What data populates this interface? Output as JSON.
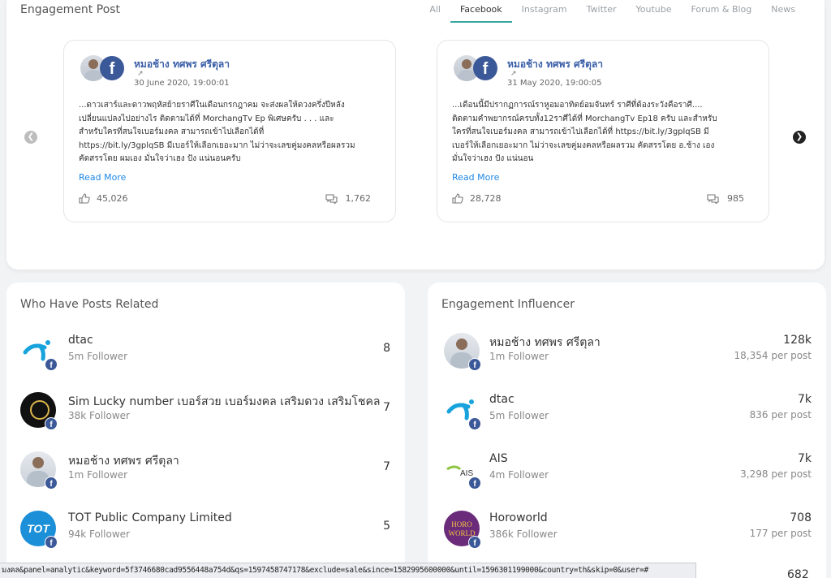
{
  "engagement_post": {
    "title": "Engagement Post",
    "tabs": [
      "All",
      "Facebook",
      "Instagram",
      "Twitter",
      "Youtube",
      "Forum & Blog",
      "News"
    ],
    "active_tab": "Facebook",
    "posts": [
      {
        "author": "หมอช้าง ทศพร ศรีตุลา",
        "date": "30 June 2020, 19:00:01",
        "text_lines": [
          "...ดาวเสาร์และดาวพฤหัสย้ายราศีในเดือนกรกฎาคม จะส่งผลให้ดวงครึ่งปีหลัง",
          "เปลี่ยนแปลงไปอย่างไร ติดตามได้ที่ MorchangTv Ep พิเศษครับ . . . และ",
          "สำหรับใครที่สนใจเบอร์มงคล สามารถเข้าไปเลือกได้ที่",
          "https://bit.ly/3gplqSB มีเบอร์ให้เลือกเยอะมาก ไม่ว่าจะเลขคู่มงคลหรือผลรวม",
          "คัดสรรโดย ผมเอง มั่นใจว่าเฮง ปัง แน่นอนครับ"
        ],
        "read_more": "Read More",
        "likes": "45,026",
        "comments": "1,762"
      },
      {
        "author": "หมอช้าง ทศพร ศรีตุลา",
        "date": "31 May 2020, 19:00:05",
        "text_lines": [
          "...เดือนนี้มีปรากฏการณ์ราหูอมอาทิตย์อมจันทร์ ราศีที่ต้องระวังคือราศี....",
          "ติดตามคำพยากรณ์ครบทั้ง12ราศีได้ที่ MorchangTv Ep18 ครับ และสำหรับ",
          "ใครที่สนใจเบอร์มงคล สามารถเข้าไปเลือกได้ที่ https://bit.ly/3gplqSB มี",
          "เบอร์ให้เลือกเยอะมาก ไม่ว่าจะเลขคู่มงคลหรือผลรวม คัดสรรโดย อ.ช้าง เอง",
          "มั่นใจว่าเฮง ปัง แน่นอน"
        ],
        "read_more": "Read More",
        "likes": "28,728",
        "comments": "985"
      }
    ]
  },
  "who_have_posts": {
    "title": "Who Have Posts Related",
    "items": [
      {
        "name": "dtac",
        "followers": "5m Follower",
        "count": "8"
      },
      {
        "name": "Sim Lucky number เบอร์สวย เบอร์มงคล เสริมดวง เสริมโชคลาภ",
        "followers": "38k Follower",
        "count": "7"
      },
      {
        "name": "หมอช้าง ทศพร ศรีตุลา",
        "followers": "1m Follower",
        "count": "7"
      },
      {
        "name": "TOT Public Company Limited",
        "followers": "94k Follower",
        "count": "5"
      }
    ]
  },
  "engagement_influencer": {
    "title": "Engagement Influencer",
    "items": [
      {
        "name": "หมอช้าง ทศพร ศรีตุลา",
        "followers": "1m Follower",
        "value": "128k",
        "per_post": "18,354 per post"
      },
      {
        "name": "dtac",
        "followers": "5m Follower",
        "value": "7k",
        "per_post": "836 per post"
      },
      {
        "name": "AIS",
        "followers": "4m Follower",
        "value": "7k",
        "per_post": "3,298 per post"
      },
      {
        "name": "Horoworld",
        "followers": "386k Follower",
        "value": "708",
        "per_post": "177 per post"
      }
    ],
    "peek_value": "682"
  },
  "avatar_labels": {
    "tot": "TOT",
    "horo": "HORO WORLD",
    "ais": "AIS",
    "fb": "f"
  },
  "status_url": "มงคล&panel=analytic&keyword=5f3746680cad9556448a754d&qs=1597458747178&exclude=sale&since=1582995600000&until=1596301199000&country=th&skip=0&user=#"
}
